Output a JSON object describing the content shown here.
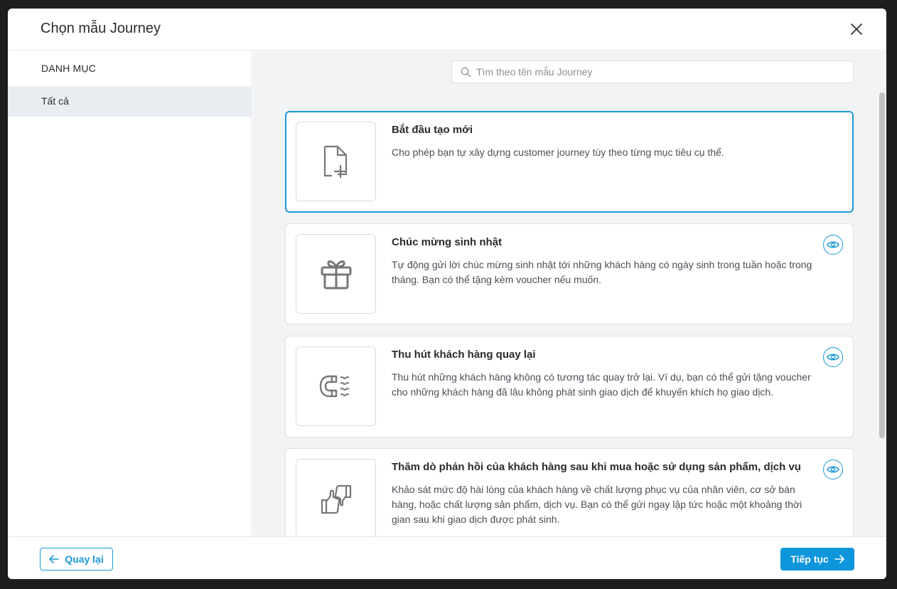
{
  "modal": {
    "title": "Chọn mẫu Journey"
  },
  "sidebar": {
    "heading": "DANH MỤC",
    "items": [
      {
        "label": "Tất cả",
        "active": true
      }
    ]
  },
  "search": {
    "placeholder": "Tìm theo tên mẫu Journey"
  },
  "templates": [
    {
      "title": "Bắt đầu tạo mới",
      "description": "Cho phép bạn tự xây dựng customer journey tùy theo từng mục tiêu cụ thể.",
      "icon": "file-plus-icon",
      "selected": true
    },
    {
      "title": "Chúc mừng sinh nhật",
      "description": "Tự động gửi lời chúc mừng sinh nhật tới những khách hàng có ngày sinh trong tuần hoặc trong tháng. Bạn có thể tặng kèm voucher nếu muốn.",
      "icon": "gift-icon",
      "selected": false
    },
    {
      "title": "Thu hút khách hàng quay lại",
      "description": "Thu hút những khách hàng không có tương tác quay trở lại. Ví dụ, bạn có thể gửi tặng voucher cho những khách hàng đã lâu không phát sinh giao dịch để khuyến khích họ giao dịch.",
      "icon": "magnet-icon",
      "selected": false
    },
    {
      "title": "Thăm dò phản hồi của khách hàng sau khi mua hoặc sử dụng sản phẩm, dịch vụ",
      "description": "Khảo sát mức độ hài lòng của khách hàng về chất lượng phục vụ của nhân viên, cơ sở bán hàng, hoặc chất lượng sản phẩm, dịch vụ. Bạn có thể gửi ngay lập tức hoặc một khoảng thời gian sau khi giao dịch được phát sinh.",
      "icon": "thumbs-feedback-icon",
      "selected": false
    }
  ],
  "footer": {
    "back_label": "Quay lại",
    "next_label": "Tiếp tục"
  },
  "colors": {
    "accent": "#1a9ad6",
    "primary_button": "#0d96dc",
    "sidebar_active": "#e9edf1",
    "content_bg": "#f2f3f5"
  }
}
